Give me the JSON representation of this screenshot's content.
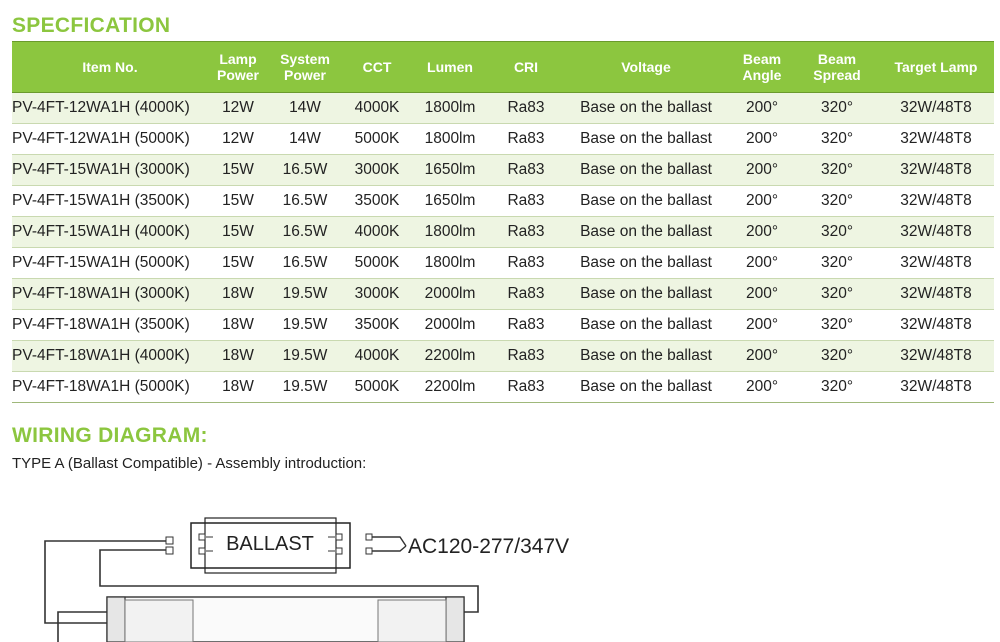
{
  "spec_title": "SPECFICATION",
  "table": {
    "headers": [
      [
        "Item No."
      ],
      [
        "Lamp",
        "Power"
      ],
      [
        "System",
        "Power"
      ],
      [
        "CCT"
      ],
      [
        "Lumen"
      ],
      [
        "CRI"
      ],
      [
        "Voltage"
      ],
      [
        "Beam",
        "Angle"
      ],
      [
        "Beam",
        "Spread"
      ],
      [
        "Target Lamp"
      ]
    ],
    "rows": [
      [
        "PV-4FT-12WA1H (4000K)",
        "12W",
        "14W",
        "4000K",
        "1800lm",
        "Ra83",
        "Base on the ballast",
        "200°",
        "320°",
        "32W/48T8"
      ],
      [
        "PV-4FT-12WA1H (5000K)",
        "12W",
        "14W",
        "5000K",
        "1800lm",
        "Ra83",
        "Base on the ballast",
        "200°",
        "320°",
        "32W/48T8"
      ],
      [
        "PV-4FT-15WA1H (3000K)",
        "15W",
        "16.5W",
        "3000K",
        "1650lm",
        "Ra83",
        "Base on the ballast",
        "200°",
        "320°",
        "32W/48T8"
      ],
      [
        "PV-4FT-15WA1H (3500K)",
        "15W",
        "16.5W",
        "3500K",
        "1650lm",
        "Ra83",
        "Base on the ballast",
        "200°",
        "320°",
        "32W/48T8"
      ],
      [
        "PV-4FT-15WA1H (4000K)",
        "15W",
        "16.5W",
        "4000K",
        "1800lm",
        "Ra83",
        "Base on the ballast",
        "200°",
        "320°",
        "32W/48T8"
      ],
      [
        "PV-4FT-15WA1H (5000K)",
        "15W",
        "16.5W",
        "5000K",
        "1800lm",
        "Ra83",
        "Base on the ballast",
        "200°",
        "320°",
        "32W/48T8"
      ],
      [
        "PV-4FT-18WA1H (3000K)",
        "18W",
        "19.5W",
        "3000K",
        "2000lm",
        "Ra83",
        "Base on the ballast",
        "200°",
        "320°",
        "32W/48T8"
      ],
      [
        "PV-4FT-18WA1H (3500K)",
        "18W",
        "19.5W",
        "3500K",
        "2000lm",
        "Ra83",
        "Base on the ballast",
        "200°",
        "320°",
        "32W/48T8"
      ],
      [
        "PV-4FT-18WA1H (4000K)",
        "18W",
        "19.5W",
        "4000K",
        "2200lm",
        "Ra83",
        "Base on the ballast",
        "200°",
        "320°",
        "32W/48T8"
      ],
      [
        "PV-4FT-18WA1H (5000K)",
        "18W",
        "19.5W",
        "5000K",
        "2200lm",
        "Ra83",
        "Base on the ballast",
        "200°",
        "320°",
        "32W/48T8"
      ]
    ]
  },
  "wiring_title": "WIRING DIAGRAM:",
  "wiring_subtitle": "TYPE A (Ballast Compatible) - Assembly introduction:",
  "diagram": {
    "ballast_label": "BALLAST",
    "voltage_label": "AC120-277/347V"
  },
  "colors": {
    "accent": "#8cc63f",
    "row_alt": "#eef5e2",
    "text": "#222222"
  }
}
